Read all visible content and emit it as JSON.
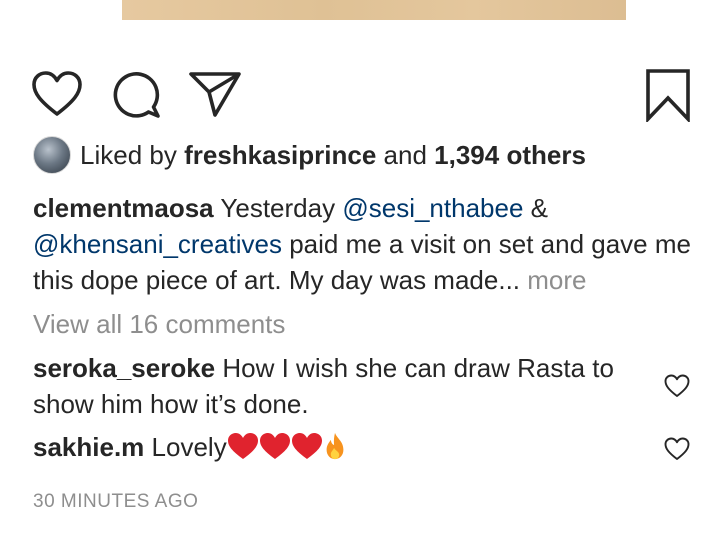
{
  "post": {
    "image_icon": "post-photo-strip",
    "actions": {
      "like_icon": "heart-outline-icon",
      "comment_icon": "comment-bubble-icon",
      "share_icon": "paper-plane-icon",
      "save_icon": "bookmark-outline-icon"
    },
    "likes": {
      "prefix": "Liked by",
      "user": "freshkasiprince",
      "middle": "and",
      "others": "1,394 others"
    },
    "caption": {
      "user": "clementmaosa",
      "text_1": "Yesterday",
      "mention_1": "@sesi_nthabee",
      "text_2": "&",
      "mention_2": "@khensani_creatives",
      "text_3": "paid me a visit on set and gave me this dope piece of art. My day was made...",
      "more": "more"
    },
    "view_all": "View all 16 comments",
    "comments": [
      {
        "user": "seroka_seroke",
        "text": "How I wish she can draw Rasta to show him how it’s done."
      },
      {
        "user": "sakhie.m",
        "text": "Lovely",
        "emojis": [
          "red-heart",
          "red-heart",
          "red-heart",
          "fire"
        ]
      }
    ],
    "timestamp": "30 MINUTES AGO"
  },
  "colors": {
    "text": "#262626",
    "muted": "#8e8e8e",
    "mention": "#00376b",
    "heart_emoji": "#e0232e",
    "fire_emoji": "#f7931e"
  }
}
